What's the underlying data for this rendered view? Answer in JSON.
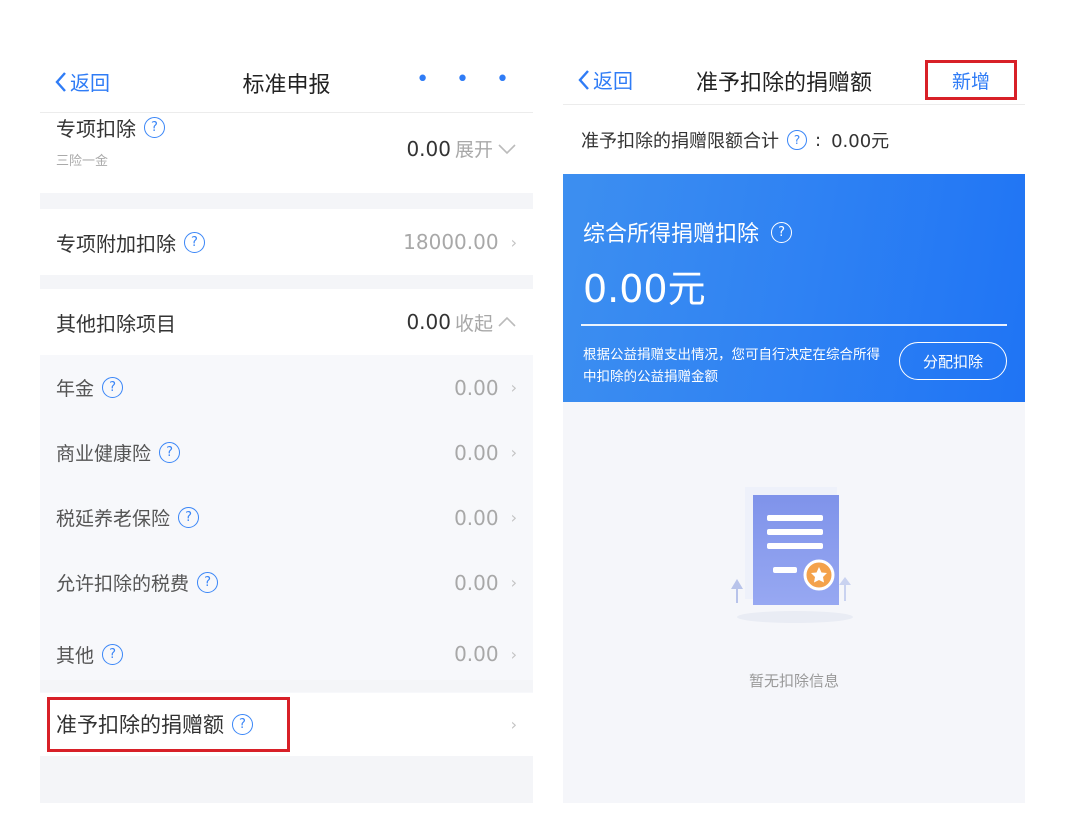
{
  "left": {
    "nav": {
      "back": "返回",
      "title": "标准申报",
      "more": "• • •"
    },
    "special_deduction": {
      "label": "专项扣除",
      "sublabel": "三险一金",
      "value": "0.00",
      "action": "展开"
    },
    "special_additional": {
      "label": "专项附加扣除",
      "value": "18000.00"
    },
    "other_items": {
      "label": "其他扣除项目",
      "value": "0.00",
      "action": "收起"
    },
    "sub_items": [
      {
        "label": "年金",
        "value": "0.00"
      },
      {
        "label": "商业健康险",
        "value": "0.00"
      },
      {
        "label": "税延养老保险",
        "value": "0.00"
      },
      {
        "label": "允许扣除的税费",
        "value": "0.00"
      },
      {
        "label": "其他",
        "value": "0.00"
      }
    ],
    "donation": {
      "label": "准予扣除的捐赠额"
    }
  },
  "right": {
    "nav": {
      "back": "返回",
      "title": "准予扣除的捐赠额",
      "add": "新增"
    },
    "limit": {
      "label": "准予扣除的捐赠限额合计",
      "colon": ":",
      "value": "0.00元"
    },
    "card": {
      "title": "综合所得捐赠扣除",
      "amount": "0.00元",
      "note": "根据公益捐赠支出情况，您可自行决定在综合所得中扣除的公益捐赠金额",
      "button": "分配扣除"
    },
    "empty_text": "暂无扣除信息"
  },
  "colors": {
    "accent": "#2f7cf6",
    "highlight": "#d82028",
    "card_blue": "#2f82f3"
  },
  "icons": {
    "back": "chevron-left-icon",
    "help": "question-circle-icon",
    "chevron": "chevron-right-icon"
  }
}
